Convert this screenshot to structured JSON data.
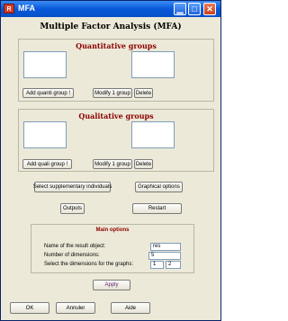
{
  "window": {
    "title": "MFA"
  },
  "main_title": "Multiple Factor Analysis (MFA)",
  "quantitative": {
    "title": "Quantitative groups",
    "add_label": "Add quanti group !",
    "modify_label": "Modify 1 group",
    "delete_label": "Delete"
  },
  "qualitative": {
    "title": "Qualitative groups",
    "add_label": "Add quali group !",
    "modify_label": "Modify 1 group",
    "delete_label": "Delete"
  },
  "actions": {
    "supplementary_label": "Select supplementary individuals",
    "graphical_label": "Graphical options",
    "outputs_label": "Outputs",
    "restart_label": "Restart"
  },
  "main_options": {
    "title": "Main options",
    "result_name_label": "Name of the result object:",
    "result_name_value": "res",
    "dimensions_label": "Number of dimensions:",
    "dimensions_value": "5",
    "graph_dims_label": "Select the dimensions for the graphs:",
    "graph_dim1": "1",
    "graph_dim2": "2"
  },
  "apply_label": "Apply",
  "footer": {
    "ok_label": "OK",
    "cancel_label": "Annuler",
    "help_label": "Aide"
  }
}
